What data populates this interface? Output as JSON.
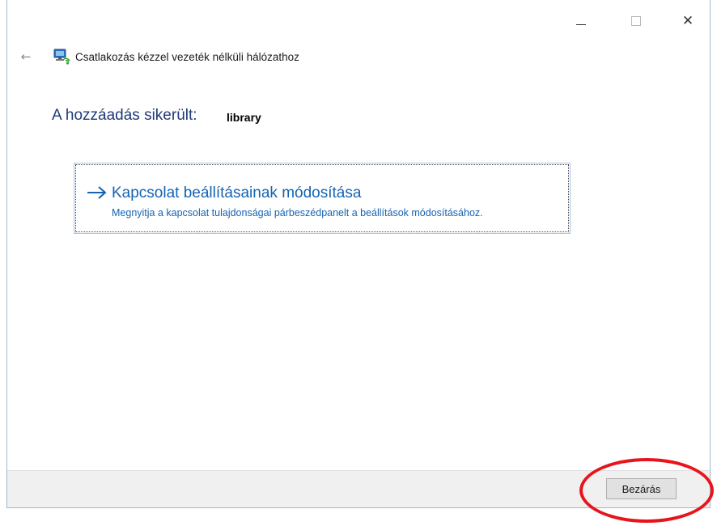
{
  "window": {
    "title": "Csatlakozás kézzel vezeték nélküli hálózathoz",
    "controls": {
      "minimize_icon": "minimize-icon",
      "maximize_icon": "maximize-icon",
      "close_icon": "close-icon",
      "close_glyph": "✕",
      "back_glyph": "←"
    }
  },
  "main": {
    "success_label": "A hozzáadás sikerült:",
    "network_name": "library",
    "command_link": {
      "title": "Kapcsolat beállításainak módosítása",
      "description": "Megnyitja a kapcsolat tulajdonságai párbeszédpanelt a beállítások módosításához."
    }
  },
  "footer": {
    "close_button_label": "Bezárás"
  },
  "colors": {
    "heading": "#1f3a78",
    "link": "#1464b4",
    "highlight_ring": "#e8141b"
  }
}
